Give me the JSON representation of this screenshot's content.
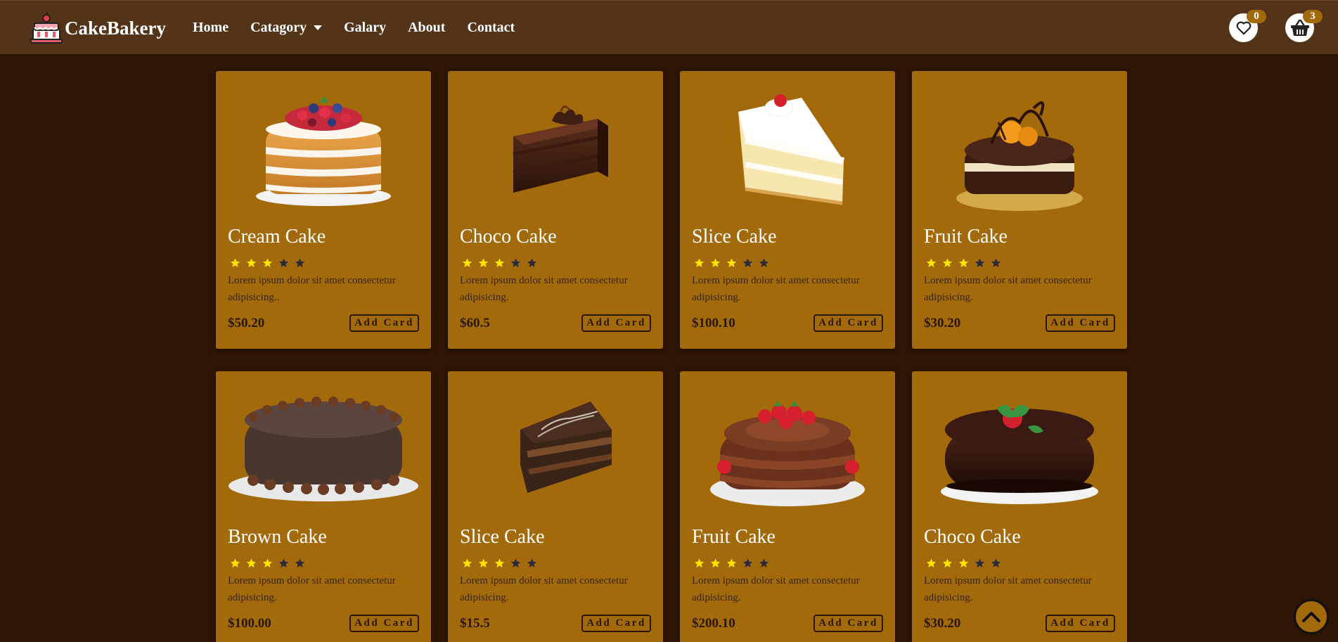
{
  "brand": {
    "name": "CakeBakery"
  },
  "nav": {
    "home": "Home",
    "category": "Catagory",
    "gallery": "Galary",
    "about": "About",
    "contact": "Contact"
  },
  "wishlist": {
    "icon": "heart-icon",
    "count": "0"
  },
  "cart": {
    "icon": "basket-icon",
    "count": "3"
  },
  "colors": {
    "background": "#2e1503",
    "navbar": "#533419",
    "card": "#a26a0b",
    "star_filled": "#ffe600",
    "star_empty": "#2a2a3a"
  },
  "products": [
    {
      "name": "Cream Cake",
      "rating": 3,
      "description": "Lorem ipsum dolor sit amet consectetur adipisicing..",
      "price": "$50.20",
      "button": "Add Card"
    },
    {
      "name": "Choco Cake",
      "rating": 3,
      "description": "Lorem ipsum dolor sit amet consectetur adipisicing.",
      "price": "$60.5",
      "button": "Add Card"
    },
    {
      "name": "Slice Cake",
      "rating": 3,
      "description": "Lorem ipsum dolor sit amet consectetur adipisicing.",
      "price": "$100.10",
      "button": "Add Card"
    },
    {
      "name": "Fruit Cake",
      "rating": 3,
      "description": "Lorem ipsum dolor sit amet consectetur adipisicing.",
      "price": "$30.20",
      "button": "Add Card"
    },
    {
      "name": "Brown Cake",
      "rating": 3,
      "description": "Lorem ipsum dolor sit amet consectetur adipisicing.",
      "price": "$100.00",
      "button": "Add Card"
    },
    {
      "name": "Slice Cake",
      "rating": 3,
      "description": "Lorem ipsum dolor sit amet consectetur adipisicing.",
      "price": "$15.5",
      "button": "Add Card"
    },
    {
      "name": "Fruit Cake",
      "rating": 3,
      "description": "Lorem ipsum dolor sit amet consectetur adipisicing.",
      "price": "$200.10",
      "button": "Add Card"
    },
    {
      "name": "Choco Cake",
      "rating": 3,
      "description": "Lorem ipsum dolor sit amet consectetur adipisicing.",
      "price": "$30.20",
      "button": "Add Card"
    }
  ],
  "scroll_top": {
    "icon": "chevron-up-icon"
  }
}
